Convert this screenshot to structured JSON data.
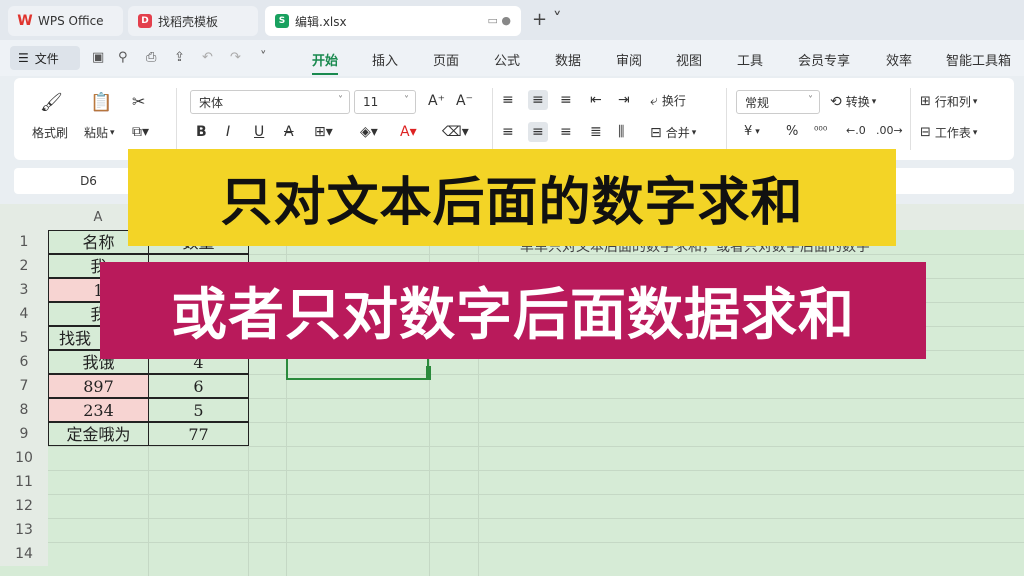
{
  "tabs": [
    {
      "label": "WPS Office"
    },
    {
      "label": "找稻壳模板"
    },
    {
      "label": "编辑.xlsx"
    }
  ],
  "menu": {
    "file": "文件",
    "items": [
      "开始",
      "插入",
      "页面",
      "公式",
      "数据",
      "审阅",
      "视图",
      "工具",
      "会员专享",
      "效率",
      "智能工具箱"
    ]
  },
  "ribbon": {
    "format_painter": "格式刷",
    "paste": "粘贴",
    "font_name": "宋体",
    "font_size": "11",
    "wrap": "换行",
    "merge": "合并",
    "number_format": "常规",
    "convert": "转换",
    "row_col": "行和列",
    "worksheet": "工作表",
    "currency": "¥",
    "percent": "%"
  },
  "formula_bar": {
    "name_box": "D6"
  },
  "sheet": {
    "columns": [
      "A"
    ],
    "rows": [
      "1",
      "2",
      "3",
      "4",
      "5",
      "6",
      "7",
      "8",
      "9",
      "10",
      "11",
      "12",
      "13",
      "14"
    ],
    "cells": {
      "a1": "名称",
      "b1": "数量",
      "a2": "我",
      "a3": "1",
      "a4": "我",
      "a5": "找我",
      "a6": "我饿",
      "b6": "4",
      "a7": "897",
      "b7": "6",
      "a8": "234",
      "b8": "5",
      "a9": "定金哦为",
      "b9": "77"
    },
    "note": "单单只对文本后面的数字求和，或者只对数字后面的数字"
  },
  "overlay": {
    "line1": "只对文本后面的数字求和",
    "line2": "或者只对数字后面数据求和"
  },
  "colors": {
    "accent": "#1a8a4f",
    "banner1": "#f3d426",
    "banner2": "#b91a5b",
    "sheet_bg": "#d6ebd6"
  }
}
